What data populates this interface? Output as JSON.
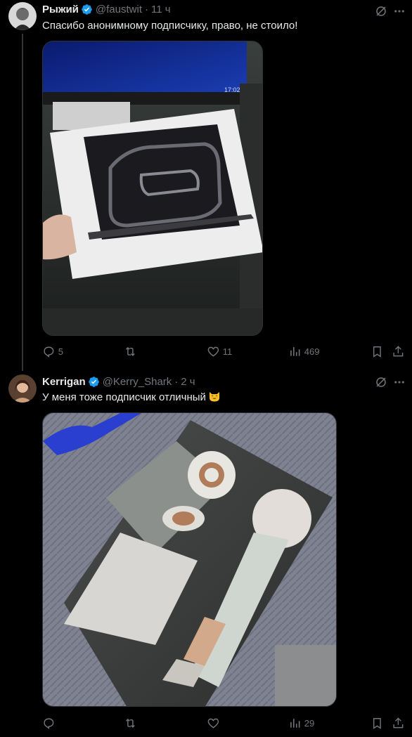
{
  "tweets": [
    {
      "name": "Рыжий",
      "handle": "@faustwit",
      "separator": "·",
      "time": "11 ч",
      "text": "Спасибо анонимному подписчику, право, не стоило!",
      "media_desc": "photo-macbook-box",
      "actions": {
        "replies": "5",
        "retweets": "",
        "likes": "11",
        "views": "469"
      }
    },
    {
      "name": "Kerrigan",
      "handle": "@Kerry_Shark",
      "separator": "·",
      "time": "2 ч",
      "text": "У меня тоже подписчик отличный",
      "media_desc": "photo-hairdryer-box",
      "actions": {
        "replies": "",
        "retweets": "",
        "likes": "",
        "views": "29"
      }
    }
  ],
  "colors": {
    "background": "#000000",
    "text_primary": "#e7e9ea",
    "text_secondary": "#71767b",
    "verified": "#1d9bf0",
    "divider": "#2f3336"
  }
}
